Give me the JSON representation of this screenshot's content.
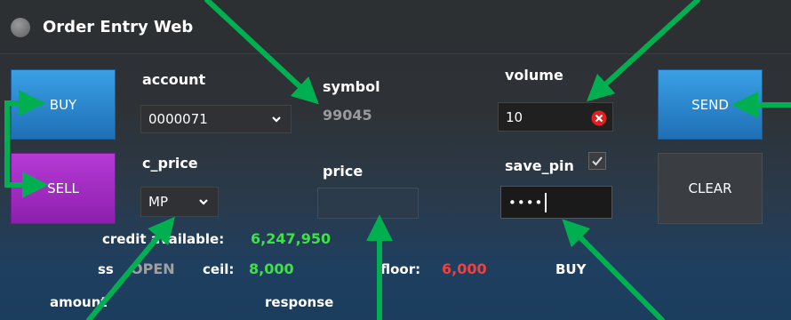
{
  "window": {
    "title": "Order Entry Web"
  },
  "buttons": {
    "buy": "BUY",
    "sell": "SELL",
    "send": "SEND",
    "clear": "CLEAR"
  },
  "fields": {
    "account_label": "account",
    "account_value": "0000071",
    "c_price_label": "c_price",
    "c_price_value": "MP",
    "symbol_label": "symbol",
    "symbol_value": "99045",
    "price_label": "price",
    "price_value": "",
    "volume_label": "volume",
    "volume_value": "10",
    "save_pin_label": "save_pin",
    "save_pin_checked": true,
    "pin_value": "••••"
  },
  "info": {
    "credit_available_label": "credit available:",
    "credit_available_value": "6,247,950",
    "ss_label": "ss",
    "ss_value": "OPEN",
    "ceil_label": "ceil:",
    "ceil_value": "8,000",
    "floor_label": "floor:",
    "floor_value": "6,000",
    "side_value": "BUY",
    "amount_label": "amount",
    "response_label": "response"
  },
  "colors": {
    "buy": "#2a86d0",
    "sell": "#a22cc4",
    "positive": "#3fe048",
    "negative": "#f04040",
    "annotation": "#00b050"
  }
}
